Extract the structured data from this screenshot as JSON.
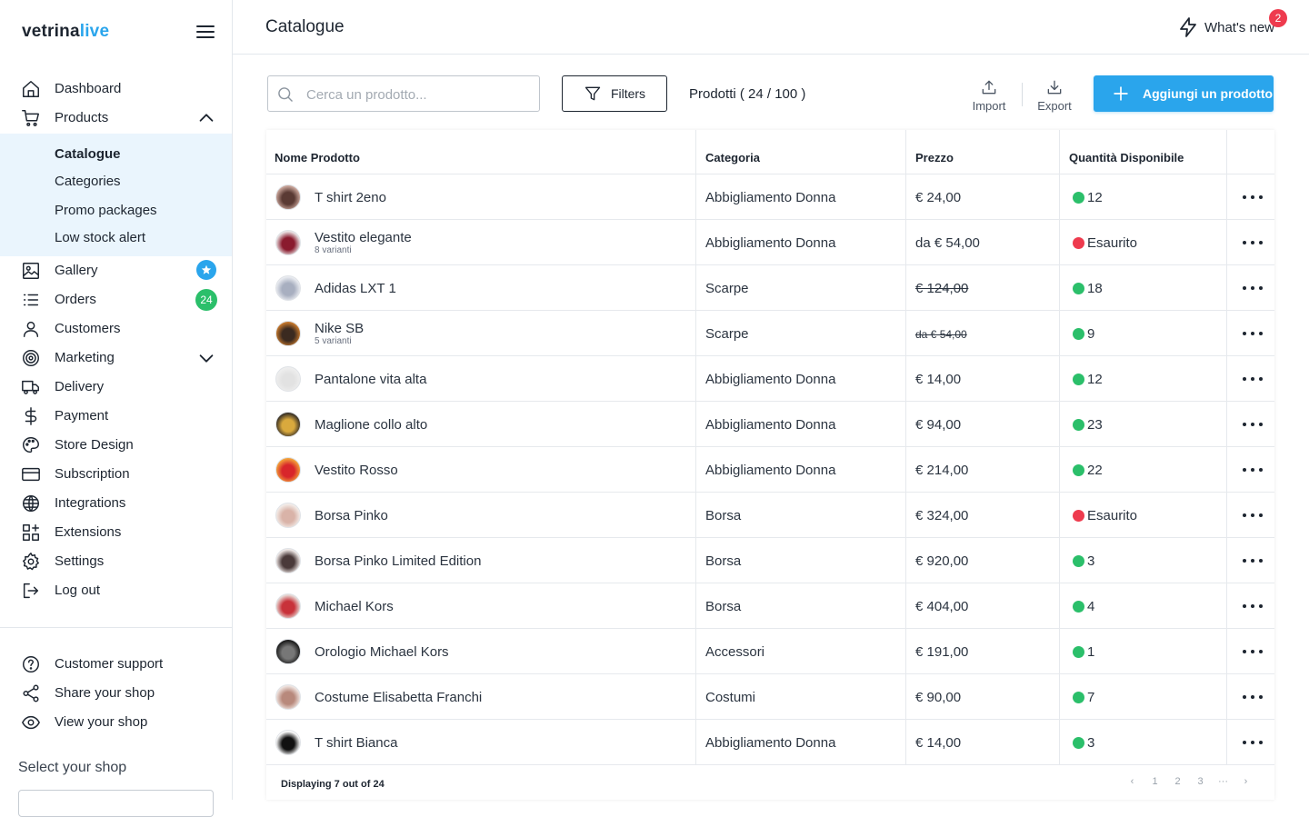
{
  "brand": {
    "part1": "vetrina",
    "part2": "live"
  },
  "sidebar": {
    "items": [
      {
        "label": "Dashboard"
      },
      {
        "label": "Products"
      },
      {
        "label": "Gallery"
      },
      {
        "label": "Orders",
        "badge": "24"
      },
      {
        "label": "Customers"
      },
      {
        "label": "Marketing"
      },
      {
        "label": "Delivery"
      },
      {
        "label": "Payment"
      },
      {
        "label": "Store Design"
      },
      {
        "label": "Subscription"
      },
      {
        "label": "Integrations"
      },
      {
        "label": "Extensions"
      },
      {
        "label": "Settings"
      },
      {
        "label": "Log out"
      }
    ],
    "sub_items": [
      {
        "label": "Catalogue"
      },
      {
        "label": "Categories"
      },
      {
        "label": "Promo packages"
      },
      {
        "label": "Low stock alert"
      }
    ],
    "bottom": [
      {
        "label": "Customer support"
      },
      {
        "label": "Share your shop"
      },
      {
        "label": "View your shop"
      }
    ],
    "select_shop_label": "Select your shop"
  },
  "header": {
    "title": "Catalogue",
    "whats_new": "What's new",
    "whats_new_count": "2"
  },
  "toolbar": {
    "search_placeholder": "Cerca un prodotto...",
    "filters_label": "Filters",
    "product_count": "Prodotti ( 24 / 100 )",
    "import_label": "Import",
    "export_label": "Export",
    "add_label": "Aggiungi un prodotto"
  },
  "table": {
    "headers": [
      "Nome Prodotto",
      "Categoria",
      "Prezzo",
      "Quantità Disponibile"
    ],
    "rows": [
      {
        "name": "T shirt 2eno",
        "variants": "",
        "category": "Abbigliamento Donna",
        "price": "€ 24,00",
        "price_style": "normal",
        "qty": "12",
        "status": "ok",
        "thumb": [
          "#c9a59a",
          "#5a3a34"
        ]
      },
      {
        "name": "Vestito elegante",
        "variants": "8 varianti",
        "category": "Abbigliamento Donna",
        "price": "da € 54,00",
        "price_style": "normal",
        "qty": "Esaurito",
        "status": "out",
        "thumb": [
          "#e8e1e2",
          "#8a1b2e"
        ]
      },
      {
        "name": "Adidas LXT 1",
        "variants": "",
        "category": "Scarpe",
        "price": "€ 124,00",
        "price_style": "strike",
        "qty": "18",
        "status": "ok",
        "thumb": [
          "#e9ebf0",
          "#a8afc0"
        ]
      },
      {
        "name": "Nike SB",
        "variants": "5 varianti",
        "category": "Scarpe",
        "price": "da € 54,00",
        "price_style": "strike-small",
        "qty": "9",
        "status": "ok",
        "thumb": [
          "#c4772c",
          "#3b2a20"
        ]
      },
      {
        "name": "Pantalone vita alta",
        "variants": "",
        "category": "Abbigliamento Donna",
        "price": "€ 14,00",
        "price_style": "normal",
        "qty": "12",
        "status": "ok",
        "thumb": [
          "#eeeeee",
          "#e2e2e2"
        ]
      },
      {
        "name": "Maglione collo alto",
        "variants": "",
        "category": "Abbigliamento Donna",
        "price": "€ 94,00",
        "price_style": "normal",
        "qty": "23",
        "status": "ok",
        "thumb": [
          "#3a3126",
          "#d9a93d"
        ]
      },
      {
        "name": "Vestito Rosso",
        "variants": "",
        "category": "Abbigliamento Donna",
        "price": "€ 214,00",
        "price_style": "normal",
        "qty": "22",
        "status": "ok",
        "thumb": [
          "#f2a13a",
          "#d8262b"
        ]
      },
      {
        "name": "Borsa Pinko",
        "variants": "",
        "category": "Borsa",
        "price": "€ 324,00",
        "price_style": "normal",
        "qty": "Esaurito",
        "status": "out",
        "thumb": [
          "#f3ece8",
          "#d9b3a8"
        ]
      },
      {
        "name": "Borsa Pinko Limited Edition",
        "variants": "",
        "category": "Borsa",
        "price": "€ 920,00",
        "price_style": "normal",
        "qty": "3",
        "status": "ok",
        "thumb": [
          "#efe8e6",
          "#4a3a3a"
        ]
      },
      {
        "name": "Michael Kors",
        "variants": "",
        "category": "Borsa",
        "price": "€ 404,00",
        "price_style": "normal",
        "qty": "4",
        "status": "ok",
        "thumb": [
          "#e7d8d4",
          "#c8323a"
        ]
      },
      {
        "name": "Orologio Michael Kors",
        "variants": "",
        "category": "Accessori",
        "price": "€ 191,00",
        "price_style": "normal",
        "qty": "1",
        "status": "ok",
        "thumb": [
          "#1b1b1b",
          "#777777"
        ]
      },
      {
        "name": "Costume Elisabetta Franchi",
        "variants": "",
        "category": "Costumi",
        "price": "€ 90,00",
        "price_style": "normal",
        "qty": "7",
        "status": "ok",
        "thumb": [
          "#efe4e0",
          "#b8897c"
        ]
      },
      {
        "name": "T shirt Bianca",
        "variants": "",
        "category": "Abbigliamento Donna",
        "price": "€ 14,00",
        "price_style": "normal",
        "qty": "3",
        "status": "ok",
        "thumb": [
          "#ffffff",
          "#111111"
        ]
      }
    ],
    "footer_info": "Displaying 7 out of 24",
    "pages": [
      "1",
      "2",
      "3",
      "···"
    ]
  },
  "colors": {
    "accent": "#2aa5ec",
    "ok": "#2bbf6a",
    "out": "#ee3b4e",
    "active_bg": "#eaf5fd"
  }
}
